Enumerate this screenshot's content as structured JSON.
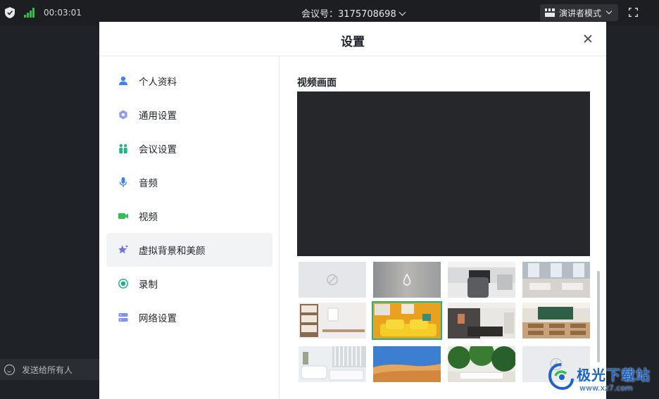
{
  "topbar": {
    "timer": "00:03:01",
    "meeting_id_label": "会议号：3175708698",
    "mode_label": "演讲者模式"
  },
  "chat": {
    "placeholder": "发送给所有人"
  },
  "dialog": {
    "title": "设置",
    "nav": [
      {
        "label": "个人资料",
        "icon": "person-icon",
        "active": false
      },
      {
        "label": "通用设置",
        "icon": "gear-icon",
        "active": false
      },
      {
        "label": "会议设置",
        "icon": "people-icon",
        "active": false
      },
      {
        "label": "音频",
        "icon": "microphone-icon",
        "active": false
      },
      {
        "label": "视频",
        "icon": "camera-icon",
        "active": false
      },
      {
        "label": "虚拟背景和美颜",
        "icon": "sparkle-icon",
        "active": true
      },
      {
        "label": "录制",
        "icon": "record-icon",
        "active": false
      },
      {
        "label": "网络设置",
        "icon": "network-icon",
        "active": false
      }
    ],
    "video_section_label": "视频画面",
    "backgrounds": [
      {
        "name": "none",
        "selected": false
      },
      {
        "name": "blur",
        "selected": false
      },
      {
        "name": "office-chair",
        "selected": false
      },
      {
        "name": "cafe",
        "selected": false
      },
      {
        "name": "shelf-room",
        "selected": false
      },
      {
        "name": "yellow-sofa",
        "selected": true
      },
      {
        "name": "meeting-room",
        "selected": false
      },
      {
        "name": "classroom",
        "selected": false
      },
      {
        "name": "white-living-room",
        "selected": false
      },
      {
        "name": "desert",
        "selected": false
      },
      {
        "name": "garden",
        "selected": false
      },
      {
        "name": "add-custom",
        "selected": false
      }
    ]
  },
  "watermark": {
    "text": "极光下载站",
    "url": "www.xz7.com"
  },
  "colors": {
    "accent": "#1fb38a",
    "nav_blue": "#3b82f6",
    "video_green": "#2fbf4f"
  }
}
